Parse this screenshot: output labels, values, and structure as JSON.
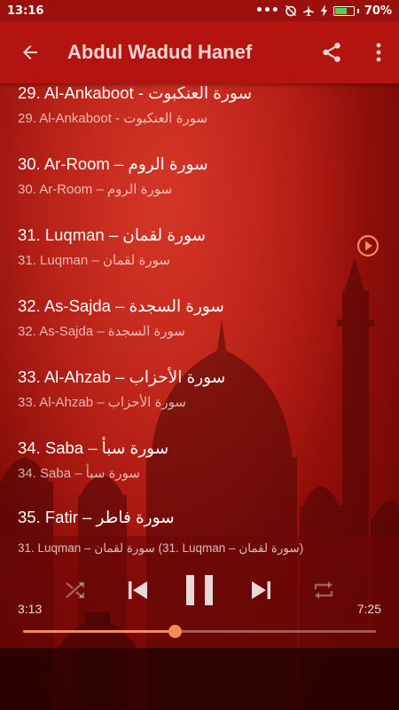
{
  "status_bar": {
    "time": "13:16",
    "battery_percent": "70%",
    "battery_level": 0.7
  },
  "app_bar": {
    "title": "Abdul Wadud Hanef",
    "back_icon": "arrow-left-icon",
    "share_icon": "share-icon",
    "menu_icon": "more-vertical-icon"
  },
  "tracks": [
    {
      "title": "29. Al-Ankaboot - سورة العنكبوت",
      "subtitle": "29. Al-Ankaboot - سورة العنكبوت"
    },
    {
      "title": "30. Ar-Room – سورة الروم",
      "subtitle": "30. Ar-Room – سورة الروم"
    },
    {
      "title": "31. Luqman – سورة لقمان",
      "subtitle": "31. Luqman – سورة لقمان",
      "playing": true
    },
    {
      "title": "32. As-Sajda – سورة السجدة",
      "subtitle": "32. As-Sajda – سورة السجدة"
    },
    {
      "title": "33. Al-Ahzab – سورة الأحزاب",
      "subtitle": "33. Al-Ahzab – سورة الأحزاب"
    },
    {
      "title": "34. Saba – سورة سبأ",
      "subtitle": "34. Saba – سورة سبأ"
    },
    {
      "title": "35. Fatir – سورة فاطر",
      "subtitle": ""
    }
  ],
  "player": {
    "now_playing": "31. Luqman – سورة لقمان (31. Luqman – سورة لقمان)",
    "current_time": "3:13",
    "total_time": "7:25",
    "progress": 0.43,
    "accent_color": "#f28a5a",
    "controls": [
      "shuffle-icon",
      "skip-previous-icon",
      "pause-icon",
      "skip-next-icon",
      "repeat-icon"
    ]
  }
}
